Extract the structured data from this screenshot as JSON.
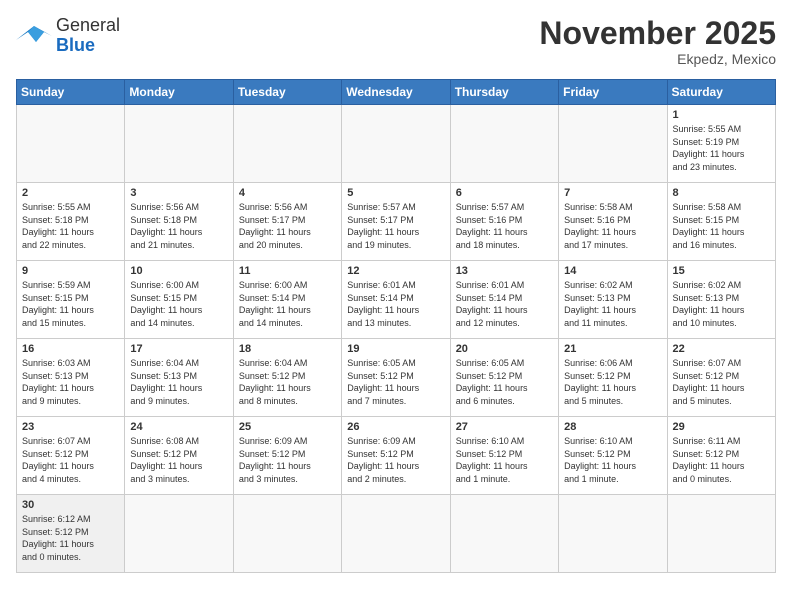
{
  "header": {
    "logo_general": "General",
    "logo_blue": "Blue",
    "month_title": "November 2025",
    "location": "Ekpedz, Mexico"
  },
  "days_of_week": [
    "Sunday",
    "Monday",
    "Tuesday",
    "Wednesday",
    "Thursday",
    "Friday",
    "Saturday"
  ],
  "weeks": [
    [
      {
        "day": "",
        "info": ""
      },
      {
        "day": "",
        "info": ""
      },
      {
        "day": "",
        "info": ""
      },
      {
        "day": "",
        "info": ""
      },
      {
        "day": "",
        "info": ""
      },
      {
        "day": "",
        "info": ""
      },
      {
        "day": "1",
        "info": "Sunrise: 5:55 AM\nSunset: 5:19 PM\nDaylight: 11 hours\nand 23 minutes."
      }
    ],
    [
      {
        "day": "2",
        "info": "Sunrise: 5:55 AM\nSunset: 5:18 PM\nDaylight: 11 hours\nand 22 minutes."
      },
      {
        "day": "3",
        "info": "Sunrise: 5:56 AM\nSunset: 5:18 PM\nDaylight: 11 hours\nand 21 minutes."
      },
      {
        "day": "4",
        "info": "Sunrise: 5:56 AM\nSunset: 5:17 PM\nDaylight: 11 hours\nand 20 minutes."
      },
      {
        "day": "5",
        "info": "Sunrise: 5:57 AM\nSunset: 5:17 PM\nDaylight: 11 hours\nand 19 minutes."
      },
      {
        "day": "6",
        "info": "Sunrise: 5:57 AM\nSunset: 5:16 PM\nDaylight: 11 hours\nand 18 minutes."
      },
      {
        "day": "7",
        "info": "Sunrise: 5:58 AM\nSunset: 5:16 PM\nDaylight: 11 hours\nand 17 minutes."
      },
      {
        "day": "8",
        "info": "Sunrise: 5:58 AM\nSunset: 5:15 PM\nDaylight: 11 hours\nand 16 minutes."
      }
    ],
    [
      {
        "day": "9",
        "info": "Sunrise: 5:59 AM\nSunset: 5:15 PM\nDaylight: 11 hours\nand 15 minutes."
      },
      {
        "day": "10",
        "info": "Sunrise: 6:00 AM\nSunset: 5:15 PM\nDaylight: 11 hours\nand 14 minutes."
      },
      {
        "day": "11",
        "info": "Sunrise: 6:00 AM\nSunset: 5:14 PM\nDaylight: 11 hours\nand 14 minutes."
      },
      {
        "day": "12",
        "info": "Sunrise: 6:01 AM\nSunset: 5:14 PM\nDaylight: 11 hours\nand 13 minutes."
      },
      {
        "day": "13",
        "info": "Sunrise: 6:01 AM\nSunset: 5:14 PM\nDaylight: 11 hours\nand 12 minutes."
      },
      {
        "day": "14",
        "info": "Sunrise: 6:02 AM\nSunset: 5:13 PM\nDaylight: 11 hours\nand 11 minutes."
      },
      {
        "day": "15",
        "info": "Sunrise: 6:02 AM\nSunset: 5:13 PM\nDaylight: 11 hours\nand 10 minutes."
      }
    ],
    [
      {
        "day": "16",
        "info": "Sunrise: 6:03 AM\nSunset: 5:13 PM\nDaylight: 11 hours\nand 9 minutes."
      },
      {
        "day": "17",
        "info": "Sunrise: 6:04 AM\nSunset: 5:13 PM\nDaylight: 11 hours\nand 9 minutes."
      },
      {
        "day": "18",
        "info": "Sunrise: 6:04 AM\nSunset: 5:12 PM\nDaylight: 11 hours\nand 8 minutes."
      },
      {
        "day": "19",
        "info": "Sunrise: 6:05 AM\nSunset: 5:12 PM\nDaylight: 11 hours\nand 7 minutes."
      },
      {
        "day": "20",
        "info": "Sunrise: 6:05 AM\nSunset: 5:12 PM\nDaylight: 11 hours\nand 6 minutes."
      },
      {
        "day": "21",
        "info": "Sunrise: 6:06 AM\nSunset: 5:12 PM\nDaylight: 11 hours\nand 5 minutes."
      },
      {
        "day": "22",
        "info": "Sunrise: 6:07 AM\nSunset: 5:12 PM\nDaylight: 11 hours\nand 5 minutes."
      }
    ],
    [
      {
        "day": "23",
        "info": "Sunrise: 6:07 AM\nSunset: 5:12 PM\nDaylight: 11 hours\nand 4 minutes."
      },
      {
        "day": "24",
        "info": "Sunrise: 6:08 AM\nSunset: 5:12 PM\nDaylight: 11 hours\nand 3 minutes."
      },
      {
        "day": "25",
        "info": "Sunrise: 6:09 AM\nSunset: 5:12 PM\nDaylight: 11 hours\nand 3 minutes."
      },
      {
        "day": "26",
        "info": "Sunrise: 6:09 AM\nSunset: 5:12 PM\nDaylight: 11 hours\nand 2 minutes."
      },
      {
        "day": "27",
        "info": "Sunrise: 6:10 AM\nSunset: 5:12 PM\nDaylight: 11 hours\nand 1 minute."
      },
      {
        "day": "28",
        "info": "Sunrise: 6:10 AM\nSunset: 5:12 PM\nDaylight: 11 hours\nand 1 minute."
      },
      {
        "day": "29",
        "info": "Sunrise: 6:11 AM\nSunset: 5:12 PM\nDaylight: 11 hours\nand 0 minutes."
      }
    ],
    [
      {
        "day": "30",
        "info": "Sunrise: 6:12 AM\nSunset: 5:12 PM\nDaylight: 11 hours\nand 0 minutes."
      },
      {
        "day": "",
        "info": ""
      },
      {
        "day": "",
        "info": ""
      },
      {
        "day": "",
        "info": ""
      },
      {
        "day": "",
        "info": ""
      },
      {
        "day": "",
        "info": ""
      },
      {
        "day": "",
        "info": ""
      }
    ]
  ]
}
